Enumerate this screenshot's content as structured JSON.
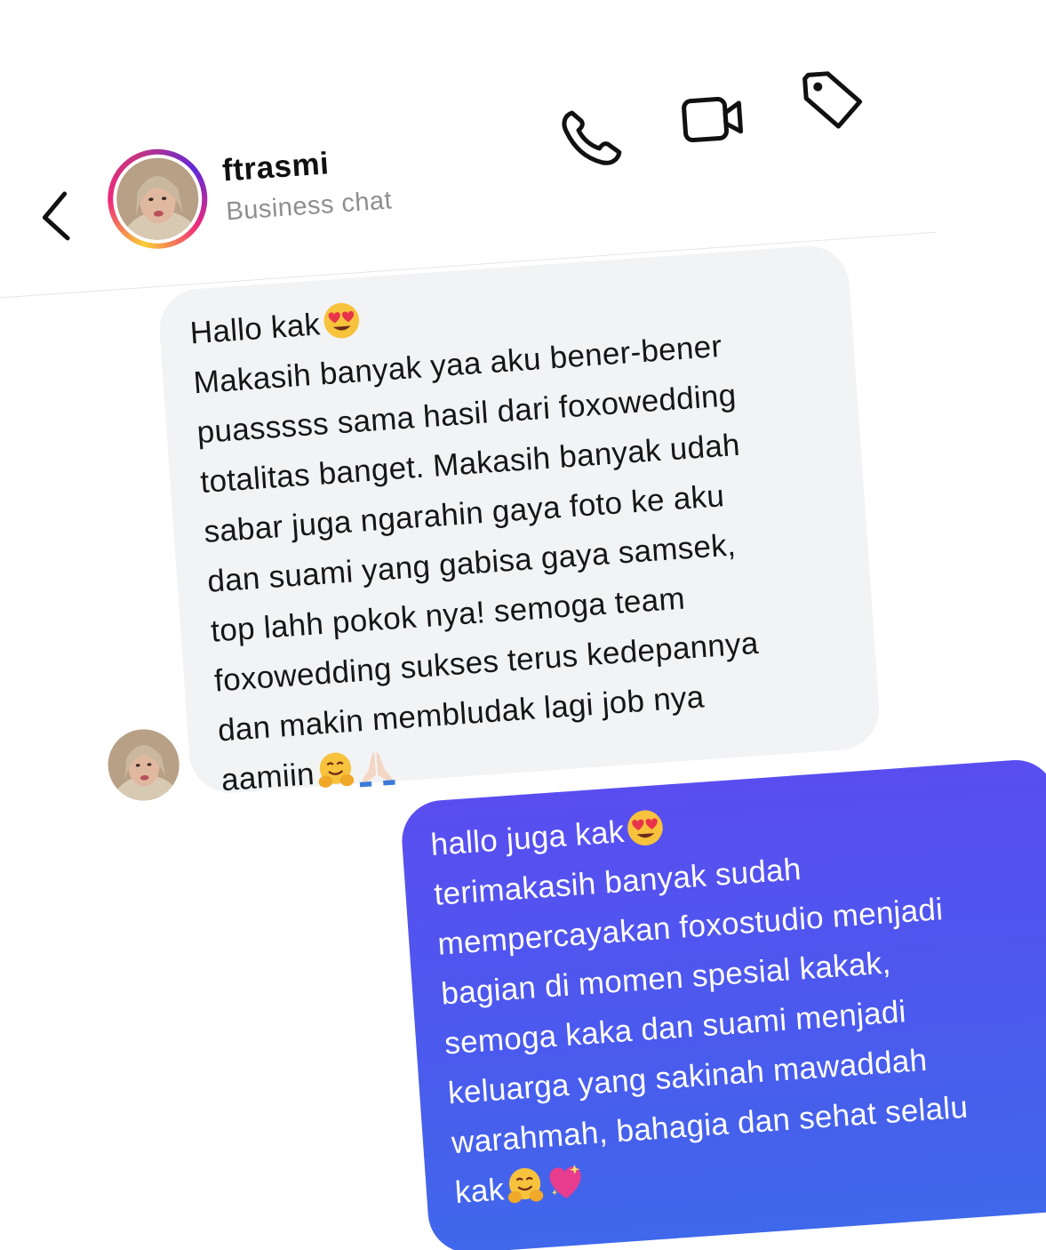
{
  "header": {
    "name": "ftrasmi",
    "subtitle": "Business chat",
    "back_icon": "chevron-left-icon",
    "actions": [
      "phone-icon",
      "video-call-icon",
      "tag-icon"
    ]
  },
  "messages": [
    {
      "direction": "incoming",
      "lines": [
        "Hallo kak",
        "Makasih banyak yaa aku bener-bener",
        "puasssss sama hasil dari foxowedding",
        "totalitas banget. Makasih banyak udah",
        "sabar juga ngarahin gaya foto ke aku",
        "dan suami yang gabisa gaya samsek,",
        "top lahh pokok nya! semoga team",
        "foxowedding sukses terus kedepannya",
        "dan makin membludak lagi job nya",
        "aamiin"
      ],
      "emojis": [
        "heart-eyes-emoji",
        "hugging-face-emoji",
        "folded-hands-emoji"
      ]
    },
    {
      "direction": "outgoing",
      "lines": [
        "hallo juga kak",
        "terimakasih banyak sudah",
        "mempercayakan foxostudio menjadi",
        "bagian di momen spesial kakak,",
        "semoga kaka dan suami menjadi",
        "keluarga yang sakinah mawaddah",
        "warahmah, bahagia dan sehat selalu",
        "kak"
      ],
      "emojis": [
        "heart-eyes-emoji",
        "hugging-face-emoji",
        "sparkling-heart-emoji"
      ]
    }
  ],
  "colors": {
    "incoming_bubble": "#f2f3f5",
    "outgoing_bubble_top": "#5a4df0",
    "outgoing_bubble_bottom": "#3f68ea",
    "subtitle": "#8e8e93"
  }
}
